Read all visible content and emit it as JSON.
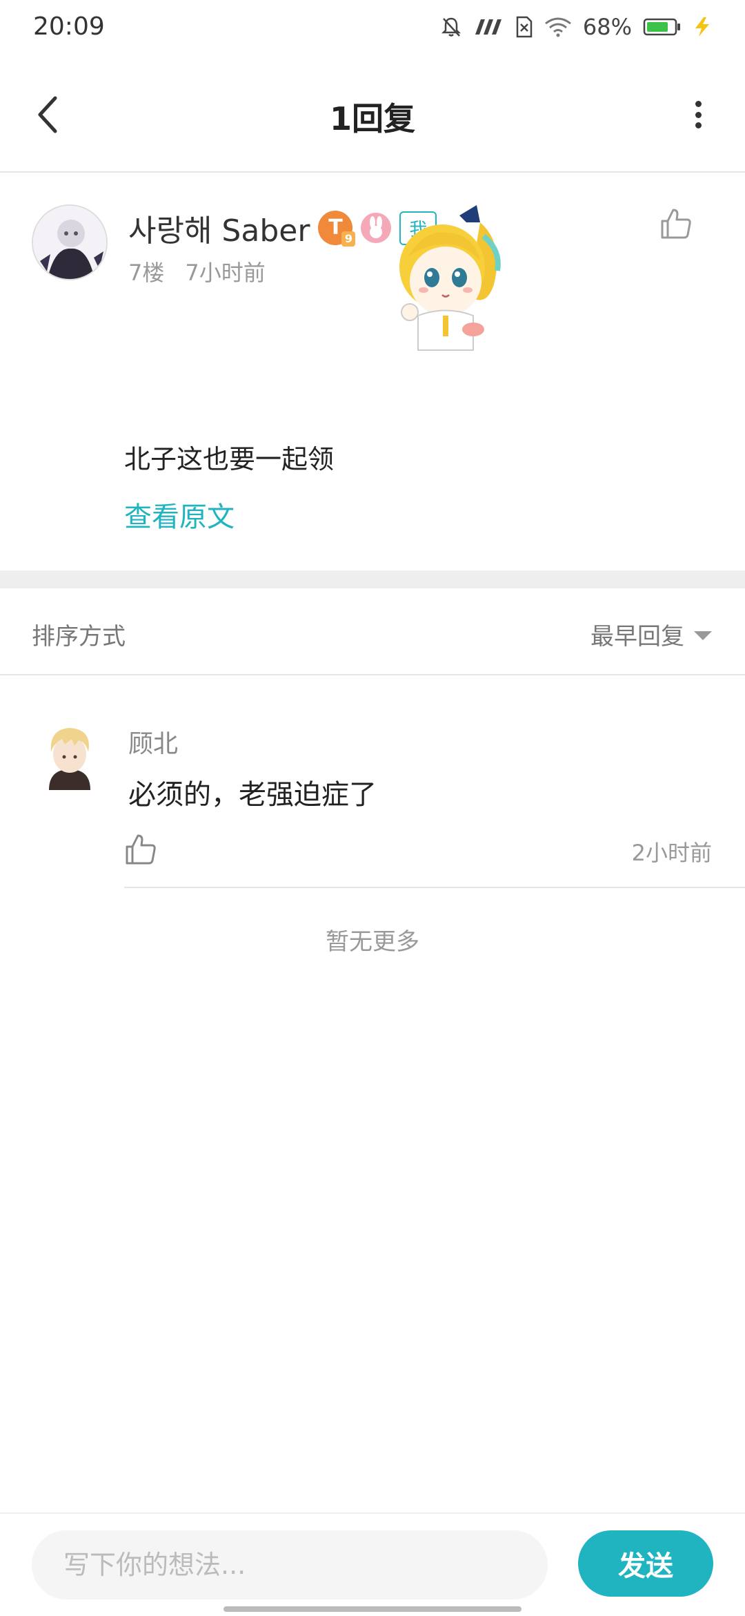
{
  "status_bar": {
    "time": "20:09",
    "battery_percent": "68%",
    "icons": [
      "bell-off-icon",
      "signal-icon",
      "sim-off-icon",
      "wifi-icon",
      "battery-icon",
      "charging-icon"
    ]
  },
  "header": {
    "title": "1回复",
    "back_icon": "chevron-left-icon",
    "more_icon": "more-vertical-icon"
  },
  "post": {
    "author": "사랑해 Saber",
    "level_badge": "T",
    "level_badge_sub": "9",
    "me_badge": "我",
    "floor": "7楼",
    "time": "7小时前",
    "content": "北子这也要一起领",
    "view_original": "查看原文"
  },
  "sort": {
    "label": "排序方式",
    "selected": "最早回复"
  },
  "replies": [
    {
      "author": "顾北",
      "text": "必须的，老强迫症了",
      "time": "2小时前"
    }
  ],
  "no_more": "暂无更多",
  "bottom_bar": {
    "placeholder": "写下你的想法...",
    "send_label": "发送"
  },
  "colors": {
    "accent": "#1fb4bf",
    "divider": "#e6e6e6",
    "muted_text": "#999999"
  }
}
